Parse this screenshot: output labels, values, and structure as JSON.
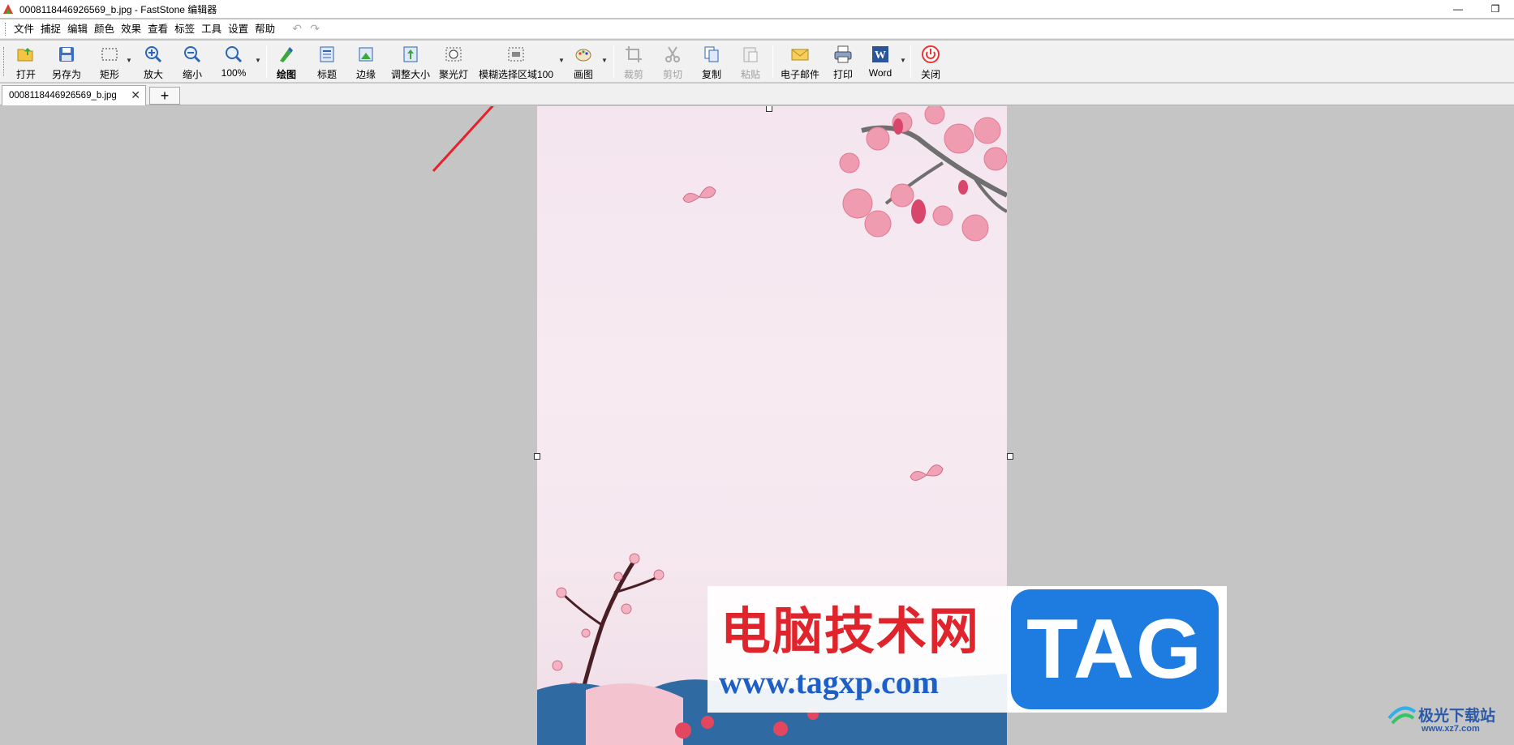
{
  "window": {
    "title": "0008118446926569_b.jpg - FastStone 编辑器",
    "minimize": "—",
    "restore": "❐"
  },
  "menu": [
    "文件",
    "捕捉",
    "编辑",
    "颜色",
    "效果",
    "查看",
    "标签",
    "工具",
    "设置",
    "帮助"
  ],
  "toolbar": {
    "open": "打开",
    "save_as": "另存为",
    "rectangle": "矩形",
    "zoom_in": "放大",
    "zoom_out": "缩小",
    "zoom_level": "100%",
    "draw": "绘图",
    "caption": "标题",
    "edge": "边缘",
    "resize": "调整大小",
    "spotlight": "聚光灯",
    "blur": "模糊选择区域100",
    "canvas": "画图",
    "crop": "裁剪",
    "cut": "剪切",
    "copy": "复制",
    "paste": "粘贴",
    "email": "电子邮件",
    "print": "打印",
    "word": "Word",
    "close": "关闭"
  },
  "tabs": {
    "active": "0008118446926569_b.jpg",
    "close_glyph": "✕",
    "new_tab": "+"
  },
  "watermark": {
    "title": "电脑技术网",
    "url": "www.tagxp.com",
    "tag": "TAG",
    "corner_name": "极光下载站",
    "corner_url": "www.xz7.com"
  },
  "colors": {
    "arrow": "#e8202a",
    "tag_blue": "#1e7be0",
    "watermark_red": "#e0242c"
  }
}
